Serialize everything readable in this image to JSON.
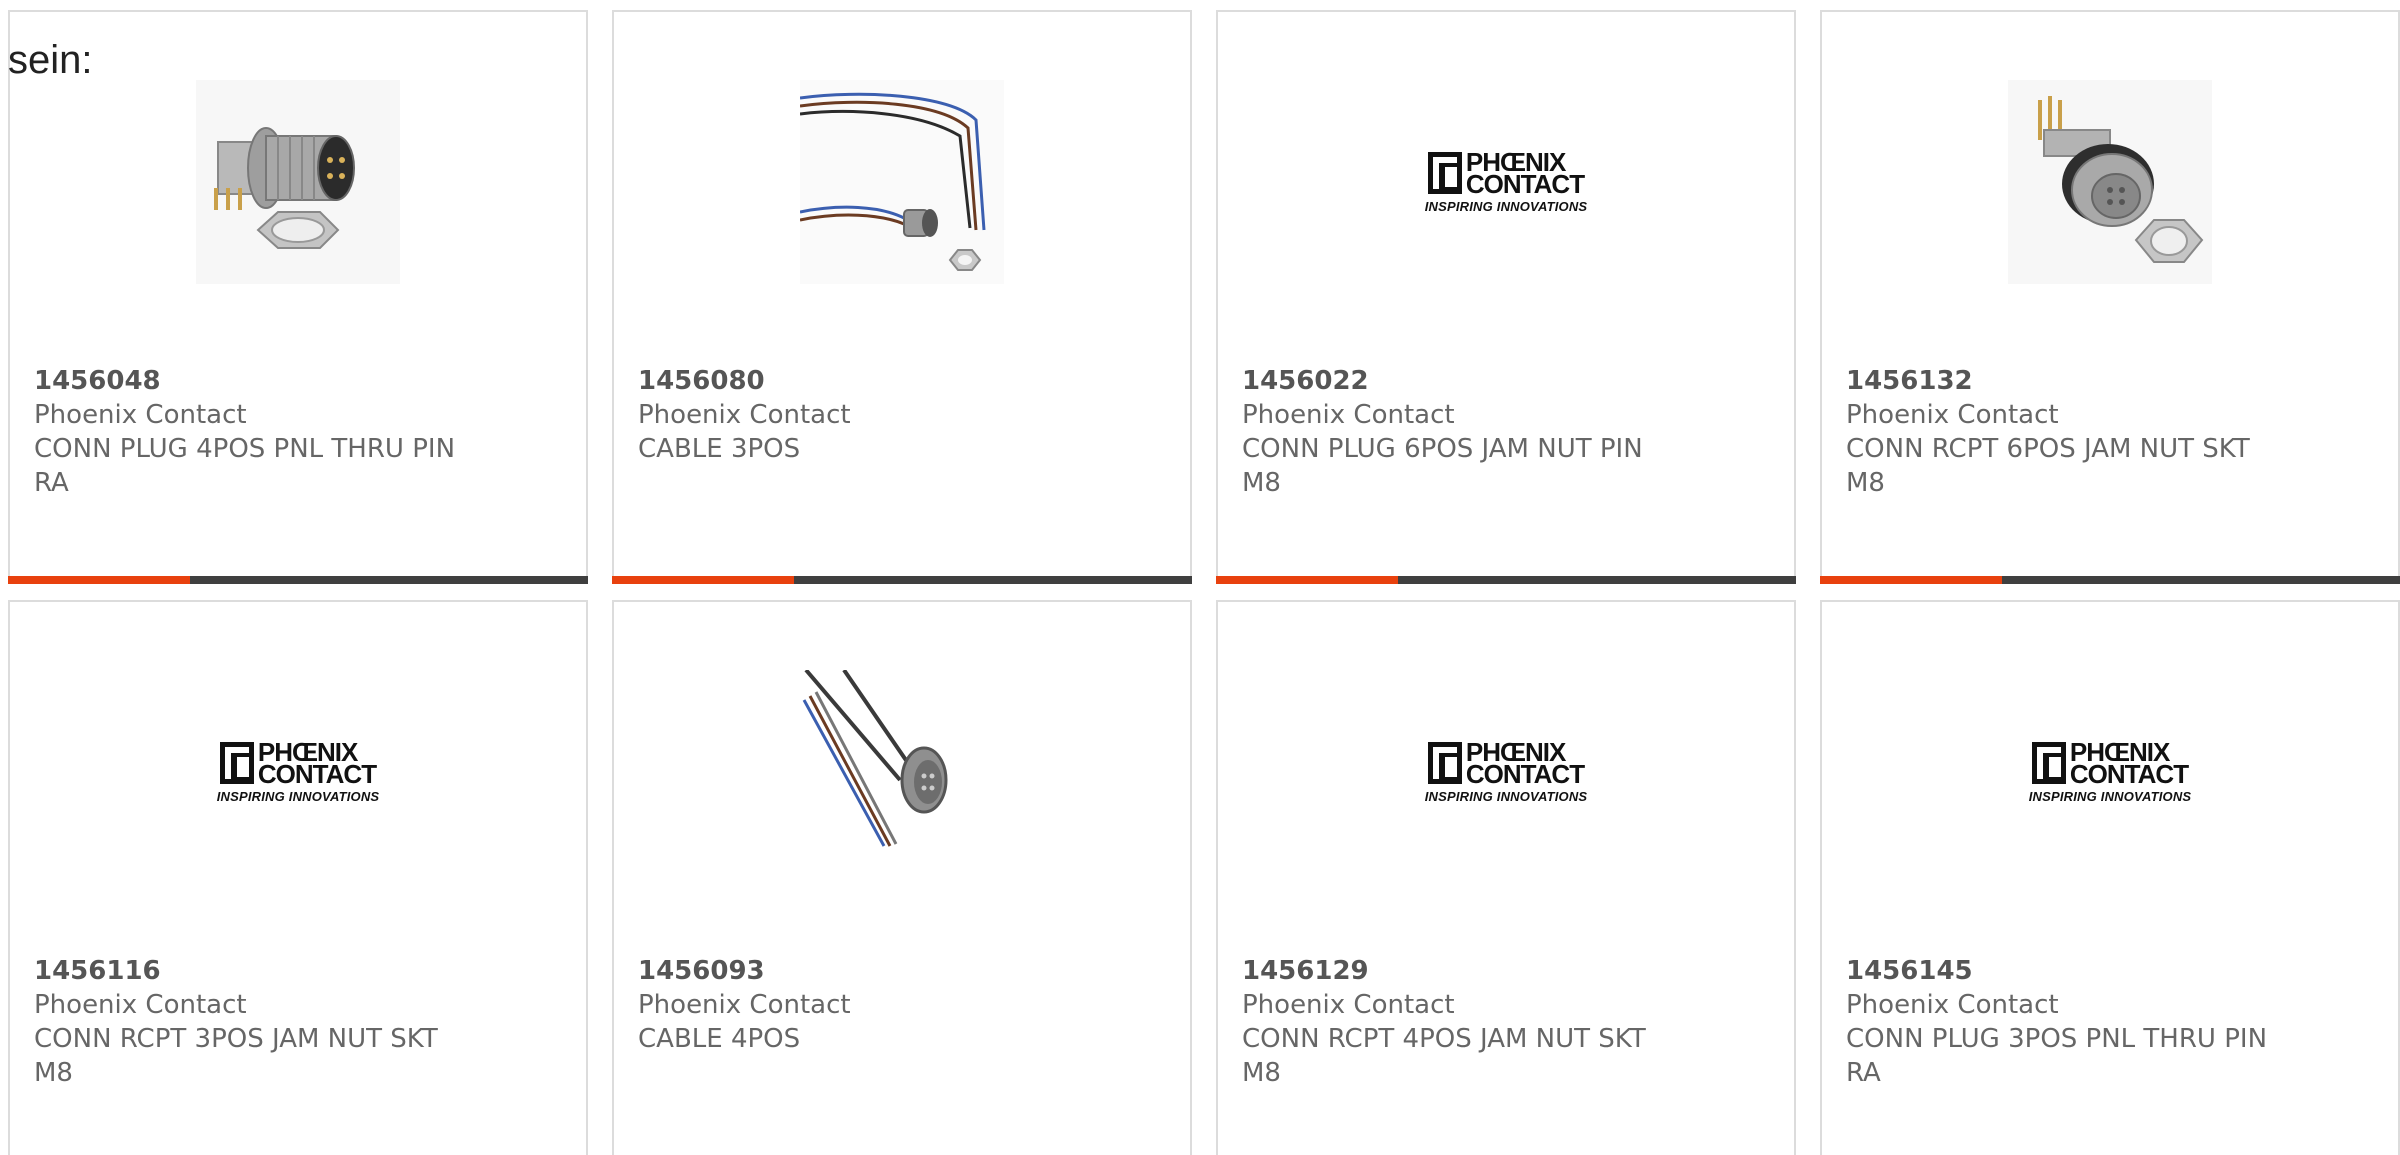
{
  "intro_text": "sein:",
  "logo": {
    "line1": "PHŒNIX",
    "line2": "CONTACT",
    "tagline": "INSPIRING INNOVATIONS"
  },
  "colors": {
    "accent": "#e8410e",
    "bar": "#3f3f3f",
    "border": "#dcdcdc",
    "text": "#666666"
  },
  "products": [
    {
      "part_number": "1456048",
      "manufacturer": "Phoenix Contact",
      "desc1": "CONN PLUG 4POS PNL THRU PIN",
      "desc2": "RA",
      "image": "connector-plug-photo"
    },
    {
      "part_number": "1456080",
      "manufacturer": "Phoenix Contact",
      "desc1": "CABLE 3POS",
      "desc2": "",
      "image": "cable-photo"
    },
    {
      "part_number": "1456022",
      "manufacturer": "Phoenix Contact",
      "desc1": "CONN PLUG 6POS JAM NUT PIN",
      "desc2": "M8",
      "image": "phoenix-logo"
    },
    {
      "part_number": "1456132",
      "manufacturer": "Phoenix Contact",
      "desc1": "CONN RCPT 6POS JAM NUT SKT",
      "desc2": "M8",
      "image": "connector-receptacle-photo"
    },
    {
      "part_number": "1456116",
      "manufacturer": "Phoenix Contact",
      "desc1": "CONN RCPT 3POS JAM NUT SKT",
      "desc2": "M8",
      "image": "phoenix-logo"
    },
    {
      "part_number": "1456093",
      "manufacturer": "Phoenix Contact",
      "desc1": "CABLE 4POS",
      "desc2": "",
      "image": "cable-photo"
    },
    {
      "part_number": "1456129",
      "manufacturer": "Phoenix Contact",
      "desc1": "CONN RCPT 4POS JAM NUT SKT",
      "desc2": "M8",
      "image": "phoenix-logo"
    },
    {
      "part_number": "1456145",
      "manufacturer": "Phoenix Contact",
      "desc1": "CONN PLUG 3POS PNL THRU PIN",
      "desc2": "RA",
      "image": "phoenix-logo"
    }
  ]
}
